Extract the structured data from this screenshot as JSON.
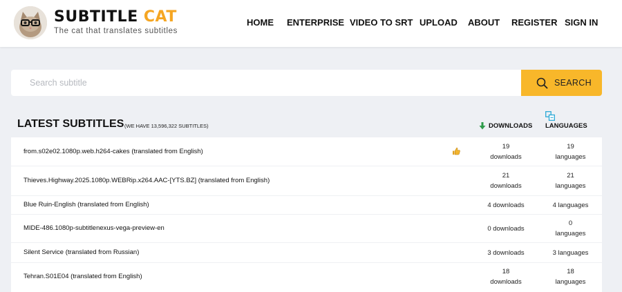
{
  "header": {
    "logo_title_main": "SUBTITLE",
    "logo_title_accent": "CAT",
    "tagline": "The cat that translates subtitles",
    "nav": [
      "HOME",
      "ENTERPRISE",
      "VIDEO TO SRT",
      "UPLOAD",
      "ABOUT",
      "REGISTER",
      "SIGN IN"
    ]
  },
  "search": {
    "placeholder": "Search subtitle",
    "button_label": "SEARCH",
    "accent_color": "#f8b72a"
  },
  "latest": {
    "title": "LATEST SUBTITLES",
    "count_text": "(WE HAVE 13,596,322 SUBTITLES)",
    "downloads_header": "DOWNLOADS",
    "languages_header": "LANGUAGES",
    "rows": [
      {
        "name": "from.s02e02.1080p.web.h264-cakes (translated from English)",
        "dl_line1": "19",
        "dl_line2": "downloads",
        "lang_line1": "19",
        "lang_line2": "languages",
        "thumb": true
      },
      {
        "name": "Thieves.Highway.2025.1080p.WEBRip.x264.AAC-[YTS.BZ] (translated from English)",
        "dl_line1": "21",
        "dl_line2": "downloads",
        "lang_line1": "21",
        "lang_line2": "languages",
        "thumb": false
      },
      {
        "name": "Blue Ruin-English (translated from English)",
        "dl_line1": "4 downloads",
        "dl_line2": "",
        "lang_line1": "4 languages",
        "lang_line2": "",
        "thumb": false
      },
      {
        "name": "MIDE-486.1080p-subtitlenexus-vega-preview-en",
        "dl_line1": "0 downloads",
        "dl_line2": "",
        "lang_line1": "0",
        "lang_line2": "languages",
        "thumb": false
      },
      {
        "name": "Silent Service (translated from Russian)",
        "dl_line1": "3 downloads",
        "dl_line2": "",
        "lang_line1": "3 languages",
        "lang_line2": "",
        "thumb": false
      },
      {
        "name": "Tehran.S01E04 (translated from English)",
        "dl_line1": "18",
        "dl_line2": "downloads",
        "lang_line1": "18",
        "lang_line2": "languages",
        "thumb": false
      }
    ]
  }
}
